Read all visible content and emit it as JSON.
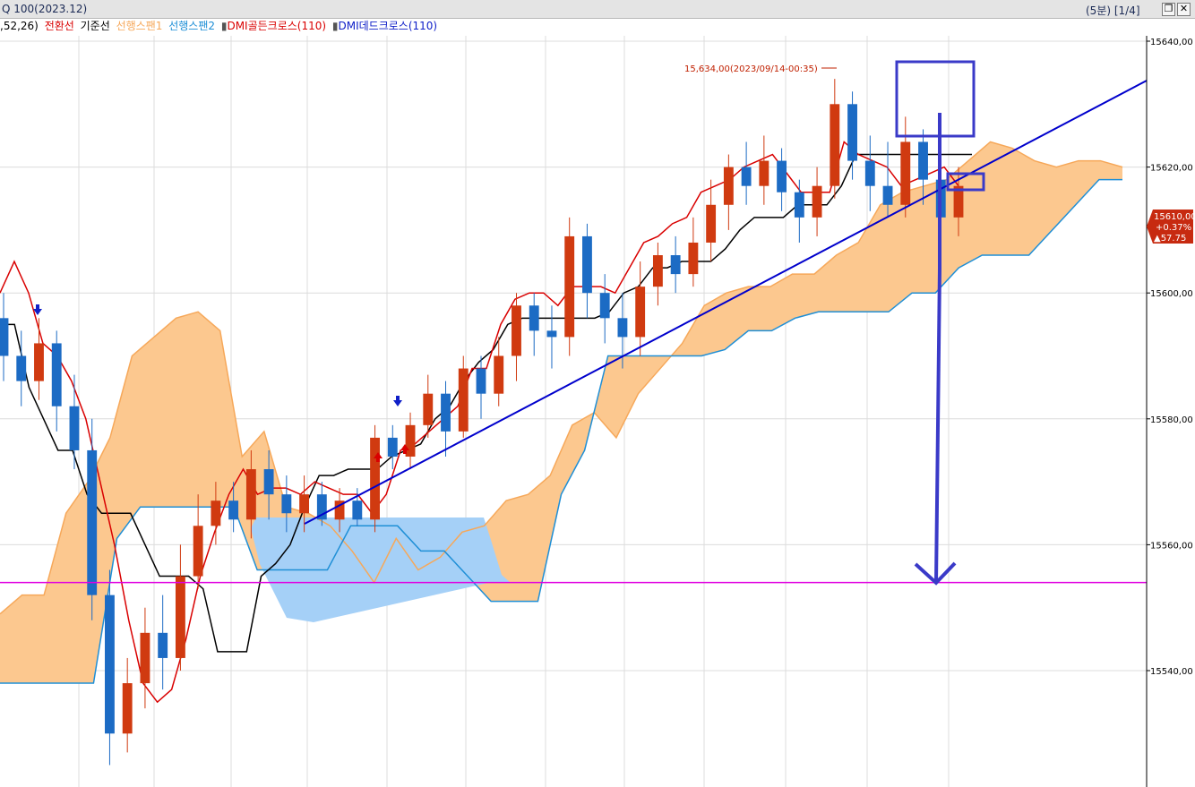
{
  "window": {
    "title": "Q 100(2023.12)",
    "period": "(5분) [1/4]",
    "restore_icon": "restore-icon",
    "close_icon": "close-icon"
  },
  "legend": {
    "params": ",52,26)",
    "items": [
      {
        "label": "전환선",
        "color": "#d90000"
      },
      {
        "label": "기준선",
        "color": "#000000"
      },
      {
        "label": "선행스팬1",
        "color": "#f6a85a"
      },
      {
        "label": "선행스팬2",
        "color": "#1f8fd6"
      },
      {
        "label": "DMI골든크로스(110)",
        "color": "#d90000",
        "marker": "▮"
      },
      {
        "label": "DMI데드크로스(110)",
        "color": "#1020c8",
        "marker": "▮"
      }
    ]
  },
  "annotations": {
    "high_label": "15,634,00(2023/09/14-00:35)",
    "last_price": "15610,00",
    "last_change_pct": "+0.37%",
    "last_change": "▲57.75"
  },
  "colors": {
    "up_candle": "#d03a10",
    "down_candle": "#1c6bc4",
    "cloud_fill": "#fcc88f",
    "cloud_fill_blue": "#a5d0f7",
    "conversion_line": "#d90000",
    "base_line": "#000000",
    "trendline": "#0000cc",
    "hline": "#e000e0",
    "drawing": "#3a3ac8"
  },
  "chart_data": {
    "type": "line",
    "title": "",
    "xlabel": "",
    "ylabel": "",
    "ylim": [
      15525,
      15645
    ],
    "y_ticks": [
      "15640,00",
      "15620,00",
      "15600,00",
      "15580,00",
      "15560,00",
      "15540,00"
    ],
    "grid": true,
    "horizontal_line": 15554,
    "high_marker": 15634,
    "last_price": 15610,
    "series": [
      {
        "name": "전환선",
        "values": [
          15600,
          15605,
          15600,
          15592,
          15590,
          15586,
          15580,
          15570,
          15560,
          15548,
          15538,
          15535,
          15537,
          15545,
          15555,
          15562,
          15568,
          15572,
          15568,
          15569,
          15569,
          15568,
          15570,
          15569,
          15568,
          15568,
          15565,
          15568,
          15575,
          15576,
          15578,
          15580,
          15582,
          15588,
          15588,
          15595,
          15599,
          15600,
          15600,
          15598,
          15601,
          15601,
          15601,
          15600,
          15604,
          15608,
          15609,
          15611,
          15612,
          15616,
          15617,
          15618,
          15620,
          15621,
          15622,
          15619,
          15616,
          15616,
          15616,
          15624,
          15622,
          15621,
          15620,
          15617,
          15618,
          15619,
          15620,
          15617
        ]
      },
      {
        "name": "기준선",
        "values": [
          15595,
          15595,
          15585,
          15580,
          15575,
          15575,
          15568,
          15565,
          15565,
          15565,
          15560,
          15555,
          15555,
          15555,
          15553,
          15543,
          15543,
          15543,
          15555,
          15557,
          15560,
          15566,
          15571,
          15571,
          15572,
          15572,
          15572,
          15574,
          15575,
          15576,
          15580,
          15582,
          15586,
          15589,
          15591,
          15595,
          15596,
          15596,
          15596,
          15596,
          15596,
          15596,
          15597,
          15600,
          15601,
          15604,
          15604,
          15605,
          15605,
          15605,
          15607,
          15610,
          15612,
          15612,
          15612,
          15614,
          15614,
          15614,
          15617,
          15622,
          15622,
          15622,
          15622,
          15622,
          15622,
          15622,
          15622,
          15622
        ]
      },
      {
        "name": "선행스팬1",
        "values": [
          15549,
          15552,
          15552,
          15565,
          15570,
          15577,
          15590,
          15593,
          15596,
          15597,
          15594,
          15574,
          15578,
          15566,
          15565,
          15563,
          15559,
          15554,
          15561,
          15556,
          15558,
          15562,
          15563,
          15567,
          15568,
          15571,
          15579,
          15581,
          15577,
          15584,
          15588,
          15592,
          15598,
          15600,
          15601,
          15601,
          15603,
          15603,
          15606,
          15608,
          15614,
          15616,
          15617,
          15618,
          15621,
          15624,
          15623,
          15621,
          15620,
          15621,
          15621,
          15620
        ]
      },
      {
        "name": "선행스팬2",
        "values": [
          15538,
          15538,
          15538,
          15538,
          15538,
          15561,
          15566,
          15566,
          15566,
          15566,
          15566,
          15556,
          15556,
          15556,
          15556,
          15563,
          15563,
          15563,
          15559,
          15559,
          15555,
          15551,
          15551,
          15551,
          15568,
          15575,
          15590,
          15590,
          15590,
          15590,
          15590,
          15591,
          15594,
          15594,
          15596,
          15597,
          15597,
          15597,
          15597,
          15600,
          15600,
          15604,
          15606,
          15606,
          15606,
          15610,
          15614,
          15618,
          15618
        ]
      }
    ],
    "candles": [
      [
        15596,
        15590,
        15600,
        15586
      ],
      [
        15590,
        15586,
        15594,
        15582
      ],
      [
        15586,
        15592,
        15596,
        15583
      ],
      [
        15592,
        15582,
        15594,
        15578
      ],
      [
        15582,
        15575,
        15587,
        15572
      ],
      [
        15575,
        15552,
        15580,
        15548
      ],
      [
        15552,
        15530,
        15556,
        15525
      ],
      [
        15530,
        15538,
        15542,
        15527
      ],
      [
        15538,
        15546,
        15550,
        15534
      ],
      [
        15546,
        15542,
        15552,
        15537
      ],
      [
        15542,
        15555,
        15560,
        15540
      ],
      [
        15555,
        15563,
        15568,
        15553
      ],
      [
        15563,
        15567,
        15570,
        15560
      ],
      [
        15567,
        15564,
        15570,
        15562
      ],
      [
        15564,
        15572,
        15575,
        15561
      ],
      [
        15572,
        15568,
        15575,
        15564
      ],
      [
        15568,
        15565,
        15571,
        15562
      ],
      [
        15565,
        15568,
        15571,
        15562
      ],
      [
        15568,
        15564,
        15570,
        15563
      ],
      [
        15564,
        15567,
        15569,
        15562
      ],
      [
        15567,
        15564,
        15569,
        15563
      ],
      [
        15564,
        15577,
        15579,
        15562
      ],
      [
        15577,
        15574,
        15579,
        15572
      ],
      [
        15574,
        15579,
        15581,
        15572
      ],
      [
        15579,
        15584,
        15587,
        15577
      ],
      [
        15584,
        15578,
        15586,
        15574
      ],
      [
        15578,
        15588,
        15590,
        15577
      ],
      [
        15588,
        15584,
        15590,
        15580
      ],
      [
        15584,
        15590,
        15593,
        15582
      ],
      [
        15590,
        15598,
        15600,
        15586
      ],
      [
        15598,
        15594,
        15600,
        15590
      ],
      [
        15594,
        15593,
        15598,
        15588
      ],
      [
        15593,
        15609,
        15612,
        15590
      ],
      [
        15609,
        15600,
        15611,
        15596
      ],
      [
        15600,
        15596,
        15603,
        15592
      ],
      [
        15596,
        15593,
        15600,
        15588
      ],
      [
        15593,
        15601,
        15605,
        15590
      ],
      [
        15601,
        15606,
        15608,
        15598
      ],
      [
        15606,
        15603,
        15609,
        15600
      ],
      [
        15603,
        15608,
        15612,
        15601
      ],
      [
        15608,
        15614,
        15618,
        15605
      ],
      [
        15614,
        15620,
        15622,
        15610
      ],
      [
        15620,
        15617,
        15624,
        15614
      ],
      [
        15617,
        15621,
        15625,
        15614
      ],
      [
        15621,
        15616,
        15623,
        15613
      ],
      [
        15616,
        15612,
        15618,
        15608
      ],
      [
        15612,
        15617,
        15620,
        15609
      ],
      [
        15617,
        15630,
        15634,
        15615
      ],
      [
        15630,
        15621,
        15632,
        15618
      ],
      [
        15621,
        15617,
        15625,
        15613
      ],
      [
        15617,
        15614,
        15624,
        15612
      ],
      [
        15614,
        15624,
        15628,
        15612
      ],
      [
        15624,
        15618,
        15626,
        15614
      ],
      [
        15618,
        15612,
        15622,
        15610
      ],
      [
        15612,
        15617,
        15620,
        15609
      ]
    ]
  }
}
